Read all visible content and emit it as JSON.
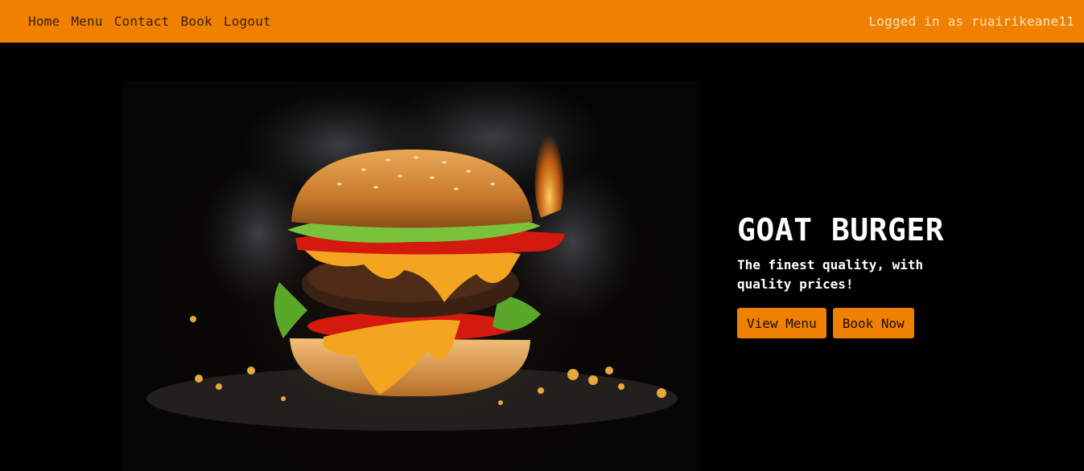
{
  "nav": {
    "links": [
      "Home",
      "Menu",
      "Contact",
      "Book",
      "Logout"
    ],
    "user_status": "Logged in as ruairikeane11"
  },
  "hero": {
    "image_icon": "burger-photo",
    "title": "GOAT BURGER",
    "subtitle": "The finest quality, with quality prices!",
    "buttons": {
      "view_menu": "View Menu",
      "book_now": "Book Now"
    }
  },
  "colors": {
    "accent": "#f08000",
    "background": "#000000",
    "text": "#ffffff"
  }
}
